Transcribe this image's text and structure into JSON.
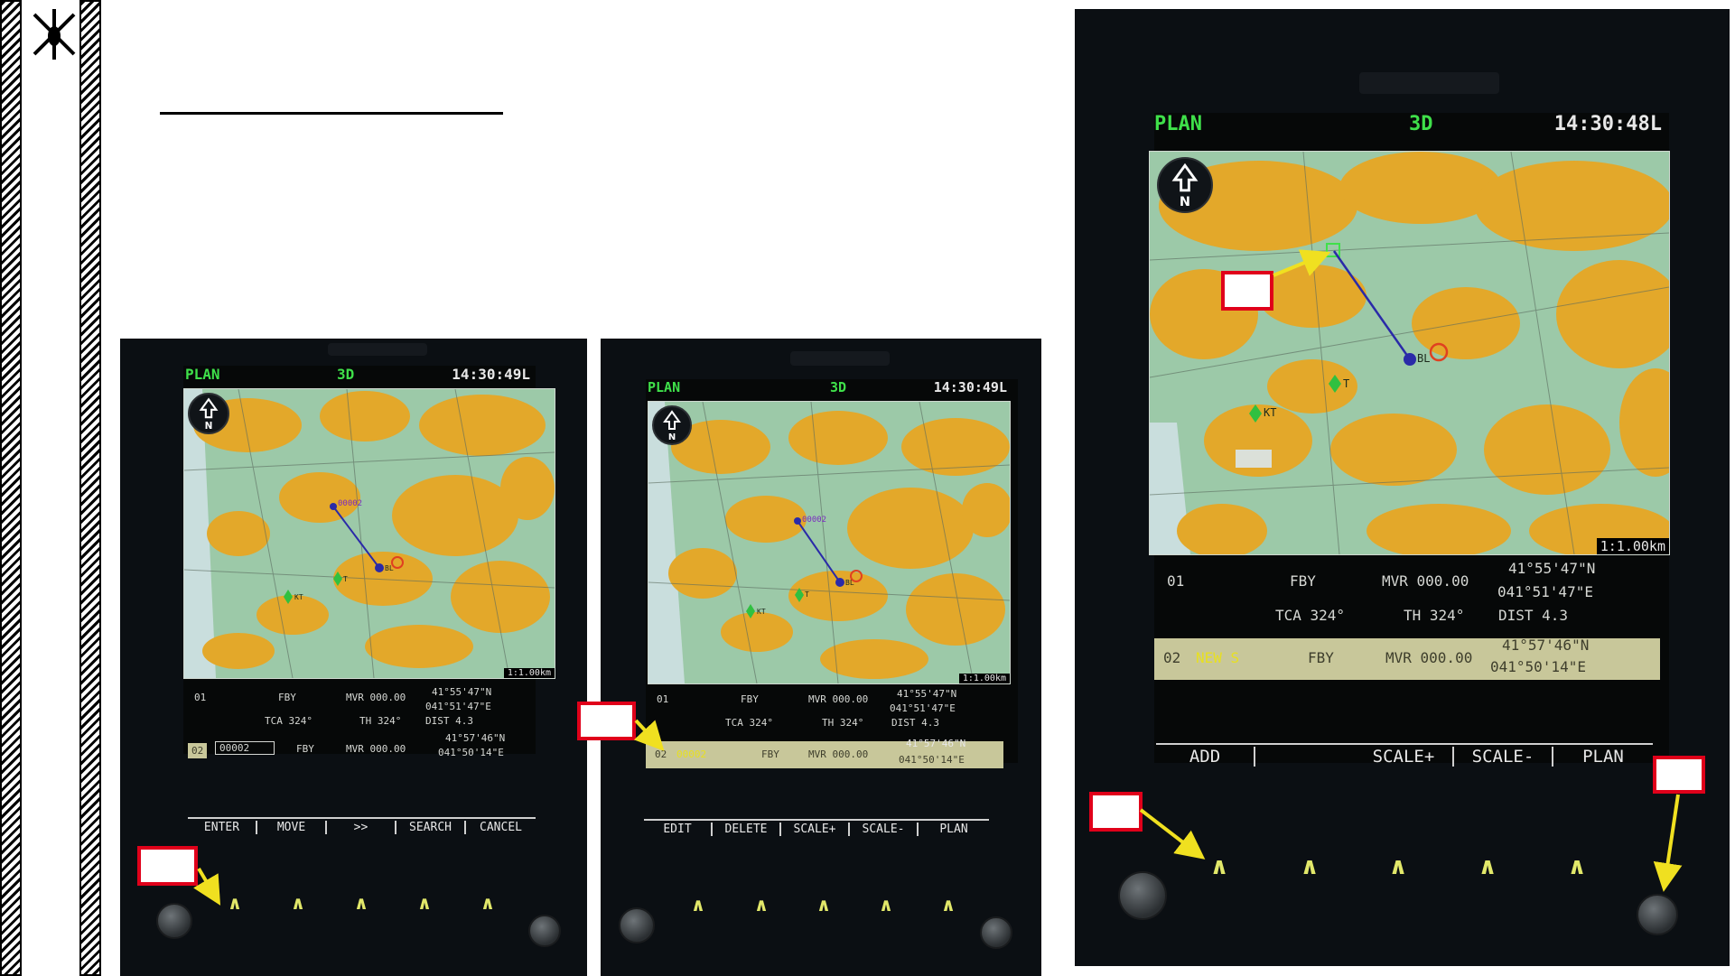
{
  "panels": [
    {
      "header": {
        "mode": "PLAN",
        "view": "3D",
        "time": "14:30:49L"
      },
      "map": {
        "scale": "1:1.00km",
        "waypoint_label": "00002",
        "markers": [
          "KT",
          "T",
          "BL"
        ]
      },
      "rows": [
        {
          "num": "01",
          "type": "FBY",
          "mvr": "MVR 000.00",
          "lat": "41°55'47\"N",
          "lon": "041°51'47\"E",
          "tca": "TCA 324°",
          "th": "TH 324°",
          "dist": "DIST 4.3"
        },
        {
          "num": "02",
          "name": "00002",
          "type": "FBY",
          "mvr": "MVR 000.00",
          "lat": "41°57'46\"N",
          "lon": "041°50'14\"E"
        }
      ],
      "softkeys": [
        "ENTER",
        "MOVE",
        ">>",
        "SEARCH",
        "CANCEL"
      ],
      "button_glyph": "∧"
    },
    {
      "header": {
        "mode": "PLAN",
        "view": "3D",
        "time": "14:30:49L"
      },
      "map": {
        "scale": "1:1.00km",
        "waypoint_label": "00002",
        "markers": [
          "KT",
          "T",
          "BL"
        ]
      },
      "rows": [
        {
          "num": "01",
          "type": "FBY",
          "mvr": "MVR 000.00",
          "lat": "41°55'47\"N",
          "lon": "041°51'47\"E",
          "tca": "TCA 324°",
          "th": "TH 324°",
          "dist": "DIST 4.3"
        },
        {
          "num": "02",
          "name": "00002",
          "type": "FBY",
          "mvr": "MVR 000.00",
          "lat": "41°57'46\"N",
          "lon": "041°50'14\"E"
        }
      ],
      "softkeys": [
        "EDIT",
        "DELETE",
        "SCALE+",
        "SCALE-",
        "PLAN"
      ],
      "button_glyph": "∧"
    },
    {
      "header": {
        "mode": "PLAN",
        "view": "3D",
        "time": "14:30:48L"
      },
      "map": {
        "scale": "1:1.00km",
        "markers": [
          "KT",
          "T",
          "BL"
        ]
      },
      "rows": [
        {
          "num": "01",
          "type": "FBY",
          "mvr": "MVR 000.00",
          "lat": "41°55'47\"N",
          "lon": "041°51'47\"E",
          "tca": "TCA 324°",
          "th": "TH 324°",
          "dist": "DIST 4.3"
        },
        {
          "num": "02",
          "name": "NEW S",
          "type": "FBY",
          "mvr": "MVR 000.00",
          "lat": "41°57'46\"N",
          "lon": "041°50'14\"E"
        }
      ],
      "softkeys": [
        "ADD",
        "",
        "SCALE+",
        "SCALE-",
        "PLAN"
      ],
      "button_glyph": "∧"
    }
  ],
  "colors": {
    "header_green": "#3fe04a",
    "map_land": "#9cc9a8",
    "map_forest": "#e3a82a",
    "route_line": "#2a2aa8",
    "highlight": "#c8c79a",
    "callout_red": "#e0001a",
    "arrow_yellow": "#f0e020"
  }
}
